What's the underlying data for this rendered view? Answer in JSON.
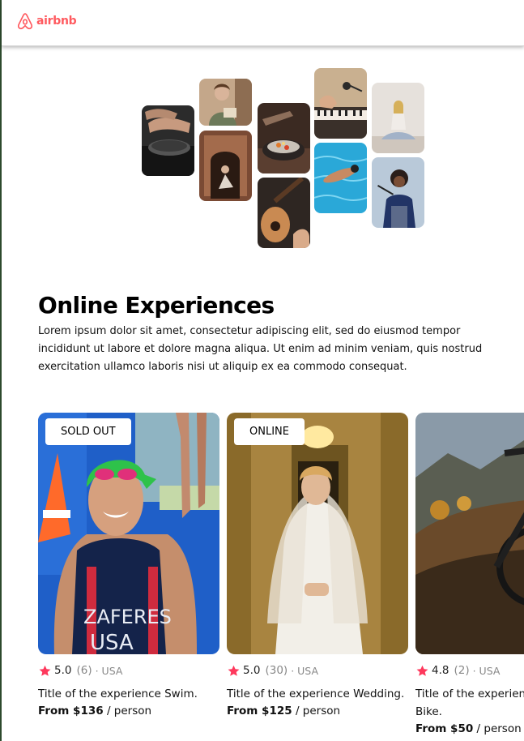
{
  "header": {
    "brand": "airbnb",
    "brand_color": "#FF5A5F"
  },
  "intro": {
    "title": "Online Experiences",
    "description": "Lorem ipsum dolor sit amet, consectetur adipiscing elit, sed do eiusmod tempor incididunt ut labore et dolore magna aliqua. Ut enim ad minim veniam, quis nostrud exercitation ullamco laboris nisi ut aliquip ex ea commodo consequat."
  },
  "cards": [
    {
      "badge": "SOLD OUT",
      "rating": "5.0",
      "reviews": "(6)",
      "location": "· USA",
      "title": "Title of the experience Swim.",
      "price": "From $136",
      "per": "/ person"
    },
    {
      "badge": "ONLINE",
      "rating": "5.0",
      "reviews": "(30)",
      "location": "· USA",
      "title": "Title of the experience Wedding.",
      "price": "From $125",
      "per": "/ person"
    },
    {
      "badge": "",
      "rating": "4.8",
      "reviews": "(2)",
      "location": "· USA",
      "title": "Title of the experience Mountain Bike.",
      "price": "From $50",
      "per": "/ person"
    }
  ],
  "colors": {
    "accent": "#FF5A5F",
    "star": "#FE385C",
    "muted_text": "#888888"
  },
  "icons": [
    "airbnb-logo-icon",
    "star-icon"
  ]
}
